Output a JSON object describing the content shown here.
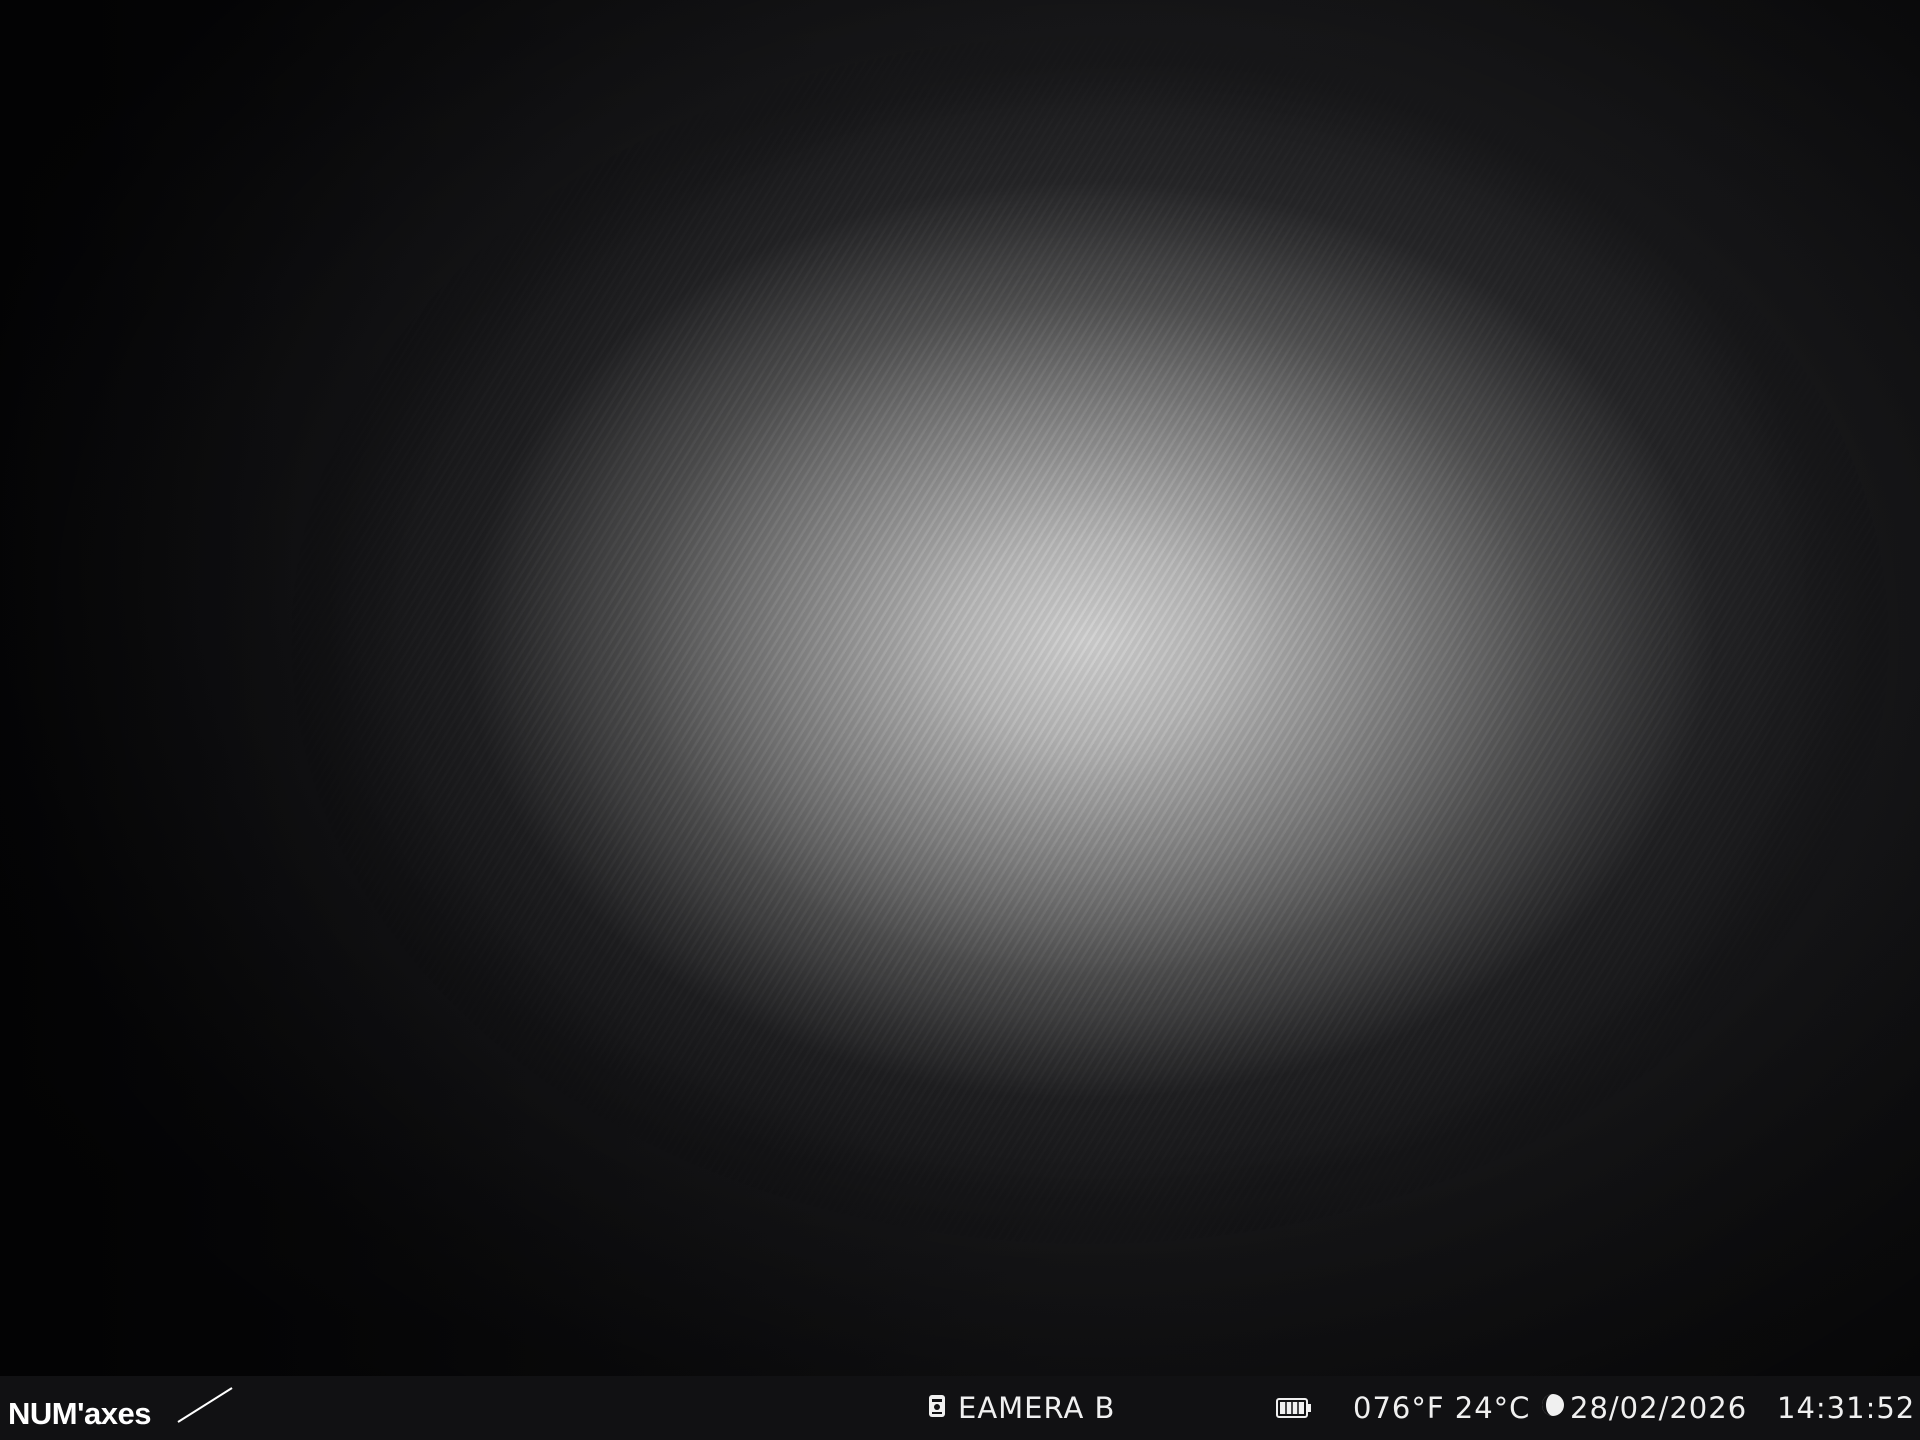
{
  "overlay": {
    "brand": "NUM'axes",
    "camera_name": "EAMERA B",
    "temperature": "076°F 24°C",
    "date": "28/02/2026",
    "time": "14:31:52",
    "icons": {
      "camera": "camera-icon",
      "battery": "battery-icon",
      "moon_phase": "moon-phase-icon"
    },
    "battery_level": 1.0
  }
}
